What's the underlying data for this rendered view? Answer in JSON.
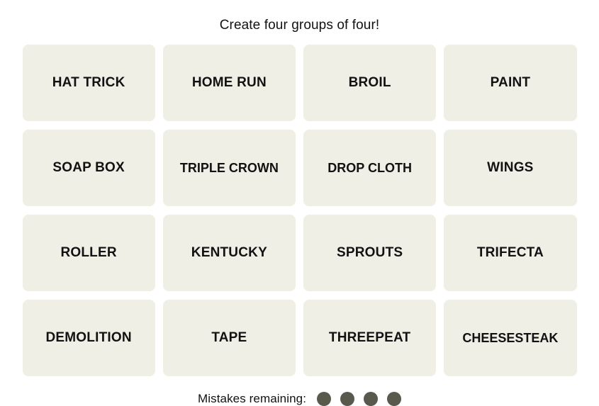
{
  "game": {
    "prompt": "Create four groups of four!",
    "tiles": [
      {
        "label": "HAT TRICK"
      },
      {
        "label": "HOME RUN"
      },
      {
        "label": "BROIL"
      },
      {
        "label": "PAINT"
      },
      {
        "label": "SOAP BOX"
      },
      {
        "label": "TRIPLE CROWN"
      },
      {
        "label": "DROP CLOTH"
      },
      {
        "label": "WINGS"
      },
      {
        "label": "ROLLER"
      },
      {
        "label": "KENTUCKY"
      },
      {
        "label": "SPROUTS"
      },
      {
        "label": "TRIFECTA"
      },
      {
        "label": "DEMOLITION"
      },
      {
        "label": "TAPE"
      },
      {
        "label": "THREEPEAT"
      },
      {
        "label": "CHEESESTEAK"
      }
    ],
    "footer": {
      "mistakes_label": "Mistakes remaining:",
      "mistakes_remaining": 4,
      "dot_color": "#5a594e"
    },
    "colors": {
      "page_background": "#ffffff",
      "tile_background": "#efefe6",
      "text": "#121212"
    }
  }
}
